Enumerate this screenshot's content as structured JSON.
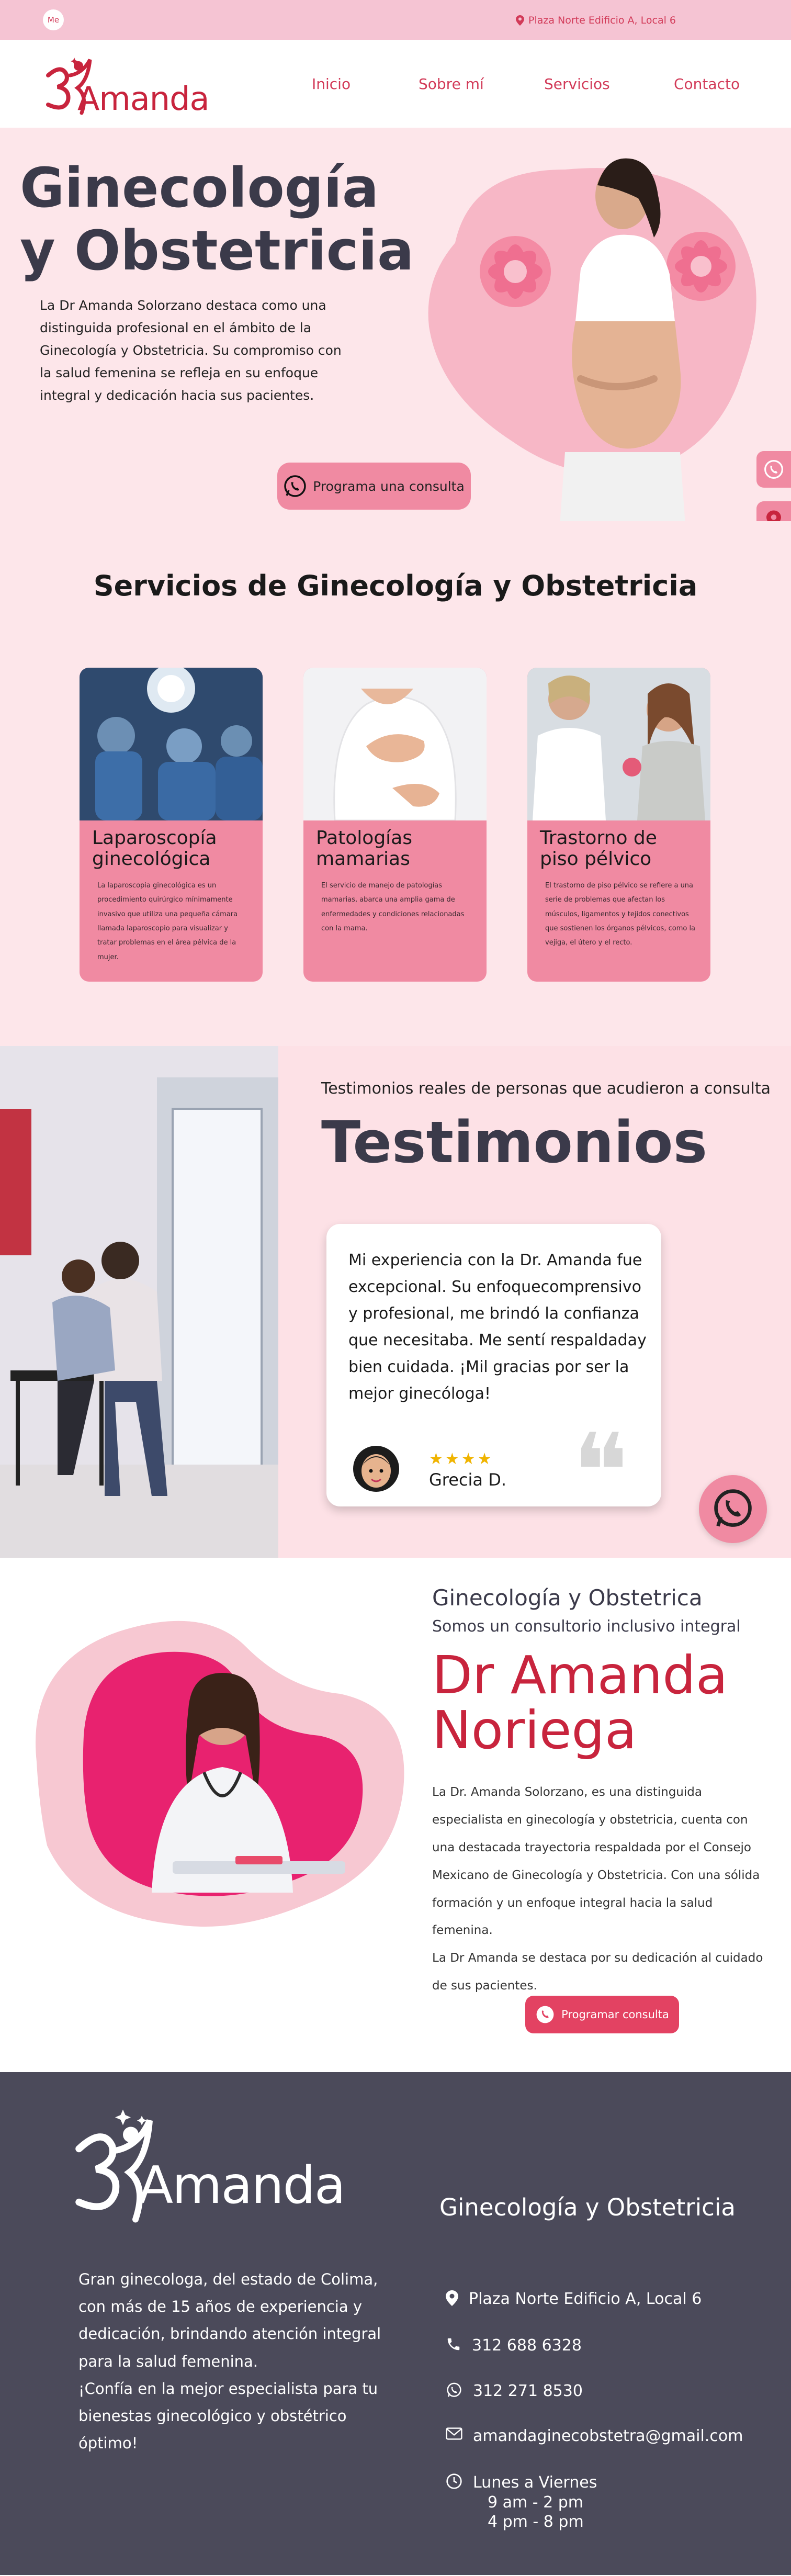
{
  "topbar": {
    "badge": "Me",
    "address": "Plaza Norte Edificio A, Local 6"
  },
  "nav": {
    "logo_text": "Amanda",
    "links": [
      "Inicio",
      "Sobre mí",
      "Servicios",
      "Contacto"
    ]
  },
  "hero": {
    "title": "Ginecología y Obstetricia",
    "text": "La Dr Amanda Solorzano destaca como una distinguida profesional en el ámbito de la Ginecología y Obstetricia. Su compromiso con la salud femenina se refleja en su enfoque integral y dedicación hacia sus pacientes.",
    "cta": "Programa una consulta"
  },
  "services": {
    "title": "Servicios de Ginecología y Obstetricia",
    "cards": [
      {
        "title": "Laparoscopía ginecológica",
        "text": "La laparoscopia ginecológica es un procedimiento quirúrgico mínimamente invasivo que utiliza una pequeña cámara llamada laparoscopio para visualizar y tratar problemas en el área pélvica de la mujer."
      },
      {
        "title": "Patologías mamarias",
        "text": "El servicio de manejo de patologías mamarias, abarca una amplia gama de enfermedades y condiciones relacionadas con la mama."
      },
      {
        "title": "Trastorno de piso pélvico",
        "text": "El trastorno de piso pélvico se refiere a una serie de problemas que afectan los músculos, ligamentos y tejidos conectivos que sostienen los órganos pélvicos, como la vejiga, el útero y el recto."
      }
    ]
  },
  "testimonials": {
    "eyebrow": "Testimonios reales de personas que acudieron a consulta",
    "title": "Testimonios",
    "quote": "Mi experiencia con la Dr. Amanda fue excepcional. Su enfoquecomprensivo y profesional, me brindó la confianza que necesitaba. Me sentí respaldaday bien cuidada. ¡Mil gracias por ser la mejor ginecóloga!",
    "stars": "★★★★",
    "name": "Grecia D.",
    "quote_mark": "❝"
  },
  "about": {
    "subtitle1": "Ginecología y Obstetrica",
    "subtitle2": "Somos un consultorio inclusivo integral",
    "name": "Dr Amanda Noriega",
    "bio1": "La Dr. Amanda Solorzano, es una distinguida especialista en ginecología y obstetricia, cuenta con una destacada trayectoria respaldada por el Consejo Mexicano de Ginecología y Obstetricia. Con una sólida formación y un enfoque integral hacia la salud femenina.",
    "bio2": "La Dr Amanda se destaca por su dedicación al cuidado de sus pacientes.",
    "cta": "Programar consulta"
  },
  "footer": {
    "logo_text": "Amanda",
    "desc1": "Gran ginecologa, del estado de Colima, con más de 15 años de experiencia y dedicación, brindando atención integral para la salud femenina.",
    "desc2": "¡Confía en la mejor especialista para tu bienestas ginecológico y obstétrico óptimo!",
    "heading": "Ginecología y Obstetricia",
    "address": "Plaza Norte Edificio A, Local 6",
    "phone": "312 688 6328",
    "whatsapp": "312 271 8530",
    "email": "amandaginecobstetra@gmail.com",
    "days": "Lunes a Viernes",
    "hours1": "9 am - 2 pm",
    "hours2": "4 pm - 8 pm"
  },
  "colors": {
    "brand_red": "#c8243d",
    "pink": "#f08aa2",
    "light_pink": "#fde6ea",
    "dark": "#4b4a5a"
  },
  "icons": [
    "location-pin-icon",
    "whatsapp-icon",
    "phone-icon",
    "mail-icon",
    "clock-icon",
    "star-icon"
  ]
}
